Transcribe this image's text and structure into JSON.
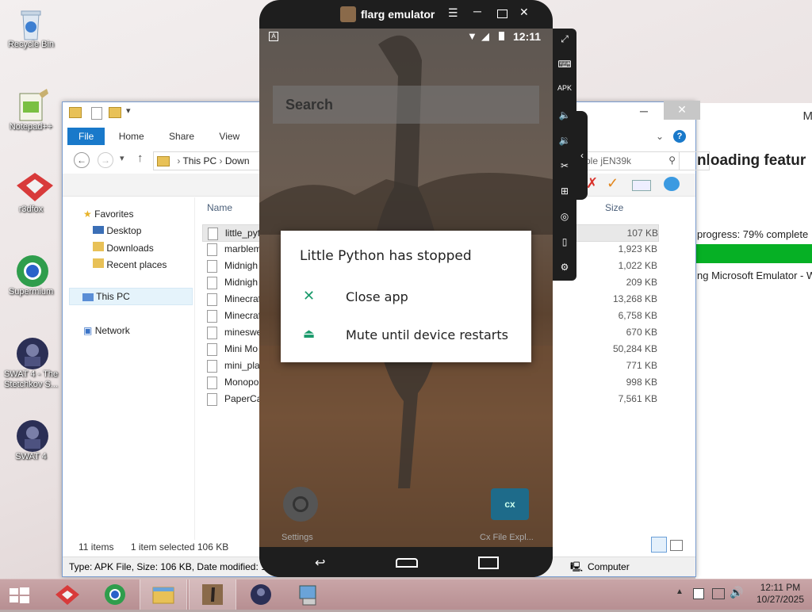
{
  "desktop": {
    "icons": [
      {
        "label": "Recycle Bin"
      },
      {
        "label": "Notepad++"
      },
      {
        "label": "r3dfox"
      },
      {
        "label": "Supermium"
      },
      {
        "label": "SWAT 4 - The Stetchkov S..."
      },
      {
        "label": "SWAT 4"
      }
    ]
  },
  "explorer": {
    "ribbon_tabs": [
      "File",
      "Home",
      "Share",
      "View"
    ],
    "breadcrumb": {
      "root": "This PC",
      "folder": "Down"
    },
    "search_placeholder": "ble jEN39k",
    "nav": {
      "favorites": "Favorites",
      "desktop": "Desktop",
      "downloads": "Downloads",
      "recent": "Recent places",
      "this_pc": "This PC",
      "network": "Network"
    },
    "columns": {
      "name": "Name",
      "size": "Size"
    },
    "files": [
      {
        "name": "little_pyt",
        "size": "107 KB"
      },
      {
        "name": "marblem",
        "size": "1,923 KB"
      },
      {
        "name": "Midnigh",
        "size": "1,022 KB"
      },
      {
        "name": "Midnigh",
        "size": "209 KB"
      },
      {
        "name": "Minecraf",
        "size": "13,268 KB"
      },
      {
        "name": "Minecraf",
        "size": "6,758 KB"
      },
      {
        "name": "mineswe",
        "size": "670 KB"
      },
      {
        "name": "Mini Mo",
        "size": "50,284 KB"
      },
      {
        "name": "mini_pla",
        "size": "771 KB"
      },
      {
        "name": "Monopo",
        "size": "998 KB"
      },
      {
        "name": "PaperCa",
        "size": "7,561 KB"
      }
    ],
    "status": {
      "items": "11 items",
      "selected": "1 item selected  106 KB"
    },
    "infobar": {
      "details": "Type: APK File, Size: 106 KB, Date modified: 10/",
      "location": "Computer"
    }
  },
  "right_window": {
    "title_fragment": "M",
    "heading": "nloading featur",
    "progress_text": "progress: 79% complete",
    "progress_fraction": 0.79,
    "detail": "ng Microsoft Emulator - W"
  },
  "emulator": {
    "title": "flarg emulator",
    "status_time": "12:11",
    "search_placeholder": "Search",
    "dialog": {
      "title": "Little Python has stopped",
      "close_label": "Close app",
      "mute_label": "Mute until device restarts"
    },
    "home_icons": {
      "settings": "Settings",
      "cx": "Cx File Expl..."
    },
    "colors": {
      "accent_green": "#1a9a6b",
      "frame": "#1e1e1e"
    }
  },
  "taskbar": {
    "time": "12:11 PM",
    "date": "10/27/2025"
  }
}
